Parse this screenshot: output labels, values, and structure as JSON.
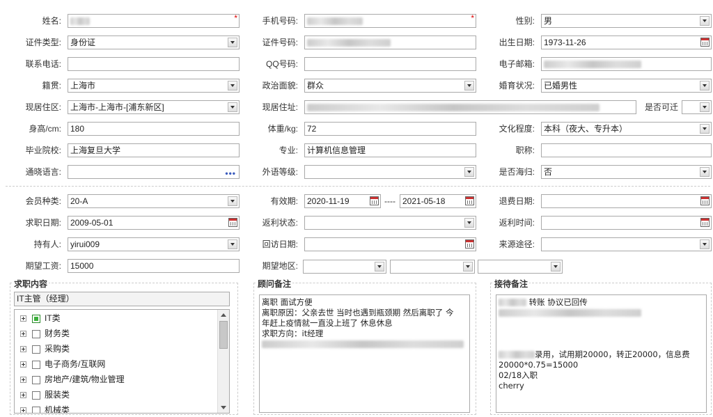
{
  "personal": {
    "name_label": "姓名:",
    "mobile_label": "手机号码:",
    "gender_label": "性别:",
    "gender_value": "男",
    "id_type_label": "证件类型:",
    "id_type_value": "身份证",
    "id_number_label": "证件号码:",
    "birth_label": "出生日期:",
    "birth_value": "1973-11-26",
    "phone_label": "联系电话:",
    "qq_label": "QQ号码:",
    "email_label": "电子邮箱:",
    "native_label": "籍贯:",
    "native_value": "上海市",
    "political_label": "政治面貌:",
    "political_value": "群众",
    "marital_label": "婚育状况:",
    "marital_value": "已婚男性",
    "residence_label": "现居住区:",
    "residence_value": "上海市-上海市-[浦东新区]",
    "address_label": "现居住址:",
    "available_label": "是否可迁",
    "height_label": "身高/cm:",
    "height_value": "180",
    "weight_label": "体重/kg:",
    "weight_value": "72",
    "education_label": "文化程度:",
    "education_value": "本科（夜大、专升本）",
    "school_label": "毕业院校:",
    "school_value": "上海复旦大学",
    "major_label": "专业:",
    "major_value": "计算机信息管理",
    "title_label": "职称:",
    "language_label": "通晓语言:",
    "language_dots": "•••",
    "foreign_label": "外语等级:",
    "returnee_label": "是否海归:",
    "returnee_value": "否"
  },
  "membership": {
    "type_label": "会员种类:",
    "type_value": "20-A",
    "validity_label": "有效期:",
    "validity_from": "2020-11-19",
    "validity_sep": "----",
    "validity_to": "2021-05-18",
    "refund_date_label": "退费日期:",
    "job_date_label": "求职日期:",
    "job_date_value": "2009-05-01",
    "rebate_status_label": "返利状态:",
    "rebate_time_label": "返利时间:",
    "holder_label": "持有人:",
    "holder_value": "yirui009",
    "visit_date_label": "回访日期:",
    "source_label": "来源途径:",
    "salary_label": "期望工资:",
    "salary_value": "15000",
    "region_label": "期望地区:"
  },
  "job_panel": {
    "title": "求职内容",
    "selected": "IT主管（经理）",
    "categories": [
      {
        "label": "IT类",
        "checked": true
      },
      {
        "label": "财务类",
        "checked": false
      },
      {
        "label": "采购类",
        "checked": false
      },
      {
        "label": "电子商务/互联网",
        "checked": false
      },
      {
        "label": "房地产/建筑/物业管理",
        "checked": false
      },
      {
        "label": "服装类",
        "checked": false
      },
      {
        "label": "机械类",
        "checked": false
      }
    ]
  },
  "advisor_panel": {
    "title": "顾问备注",
    "lines": [
      "离职 面试方便",
      "离职原因：父亲去世 当时也遇到瓶颈期 然后离职了 今",
      "年赶上疫情就一直没上班了  休息休息",
      "求职方向：it经理"
    ]
  },
  "reception_panel": {
    "title": "接待备注",
    "line1": "转账 协议已回传",
    "line2": "录用，试用期20000，转正20000，信息费",
    "line3": "20000*0.75=15000",
    "line4": "02/18入职",
    "line5": "cherry"
  }
}
